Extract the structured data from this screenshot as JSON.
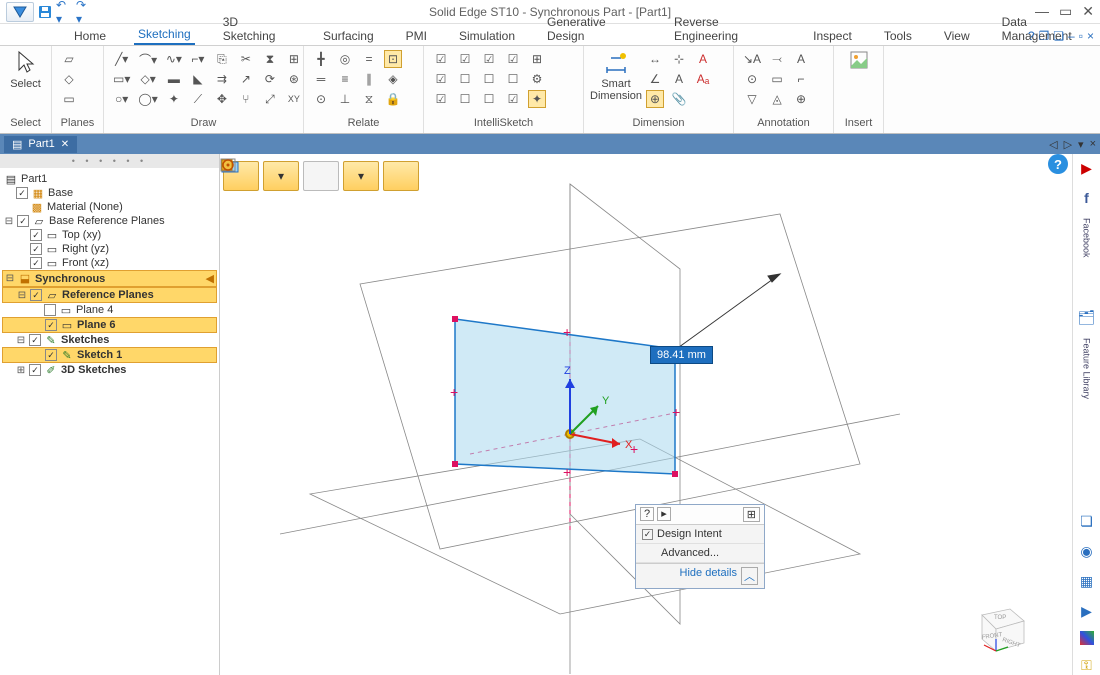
{
  "title": "Solid Edge ST10 - Synchronous Part - [Part1]",
  "tabs": [
    "Home",
    "Sketching",
    "3D Sketching",
    "Surfacing",
    "PMI",
    "Simulation",
    "Generative Design",
    "Reverse Engineering",
    "Inspect",
    "Tools",
    "View",
    "Data Management"
  ],
  "active_tab": "Sketching",
  "ribbon_groups": {
    "select": "Select",
    "planes": "Planes",
    "draw": "Draw",
    "relate": "Relate",
    "intellisketch": "IntelliSketch",
    "dimension": "Dimension",
    "smart_dim": "Smart Dimension",
    "annotation": "Annotation",
    "insert": "Insert"
  },
  "doc_tab": "Part1",
  "tree": {
    "root": "Part1",
    "base": "Base",
    "material": "Material (None)",
    "brp": "Base Reference Planes",
    "top": "Top (xy)",
    "right": "Right (yz)",
    "front": "Front (xz)",
    "sync": "Synchronous",
    "rp": "Reference Planes",
    "p4": "Plane 4",
    "p6": "Plane 6",
    "sketches": "Sketches",
    "sk1": "Sketch 1",
    "sk3d": "3D Sketches"
  },
  "dimension": "98.41 mm",
  "axes": {
    "x": "X",
    "y": "Y",
    "z": "Z"
  },
  "options_box": {
    "design_intent": "Design Intent",
    "advanced": "Advanced...",
    "hide": "Hide details"
  },
  "sidepanel": {
    "feature_lib": "Feature Library",
    "facebook": "Facebook"
  },
  "view_cube": {
    "top": "TOP",
    "front": "FRONT",
    "right": "RIGHT"
  }
}
